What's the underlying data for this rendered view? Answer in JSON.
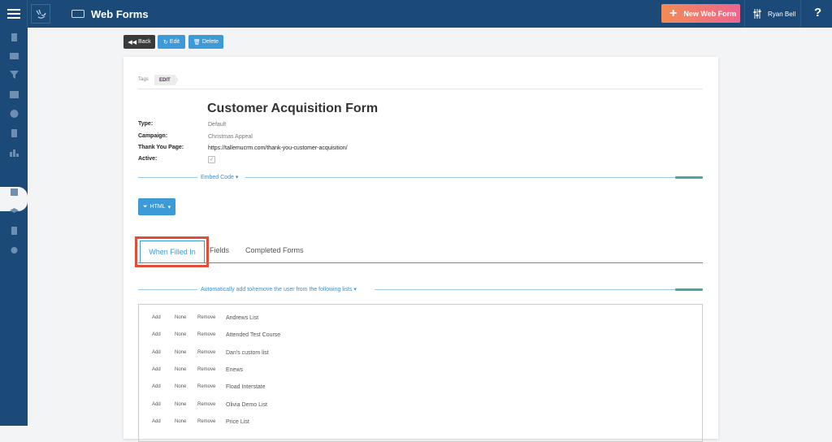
{
  "header": {
    "app_title": "Web Forms",
    "new_button_label": "New Web Form",
    "user_name": "Ryan Bell",
    "help_label": "?"
  },
  "toolbar": {
    "back_label": "Back",
    "edit_label": "Edit",
    "delete_label": "Delete"
  },
  "tags": {
    "label": "Tags",
    "items": [
      "EDIT"
    ]
  },
  "form": {
    "title": "Customer Acquisition Form",
    "fields": [
      {
        "label": "Type:",
        "value": "Default"
      },
      {
        "label": "Campaign:",
        "value": "Christmas Appeal"
      },
      {
        "label": "Thank You Page:",
        "value": "https://tallemucrm.com/thank-you-customer-acquisition/"
      },
      {
        "label": "Active:",
        "value": ""
      }
    ],
    "active_checked": true
  },
  "embed": {
    "section_label": "Embed Code",
    "html_button_label": "HTML"
  },
  "tabs": [
    {
      "label": "When Filled In",
      "active": true
    },
    {
      "label": "Fields",
      "active": false
    },
    {
      "label": "Completed Forms",
      "active": false
    }
  ],
  "lists_section": {
    "label": "Automatically add to/remove the user from the following lists",
    "option_add": "Add",
    "option_none": "None",
    "option_remove": "Remove",
    "lists": [
      "Andrews List",
      "Attended Test Course",
      "Dan's custom list",
      "Enews",
      "Fload Interstate",
      "Olivia Demo List",
      "Price List"
    ]
  },
  "colors": {
    "brand": "#1c4a78",
    "accent": "#3d9ad8",
    "highlight": "#e04e3a"
  }
}
